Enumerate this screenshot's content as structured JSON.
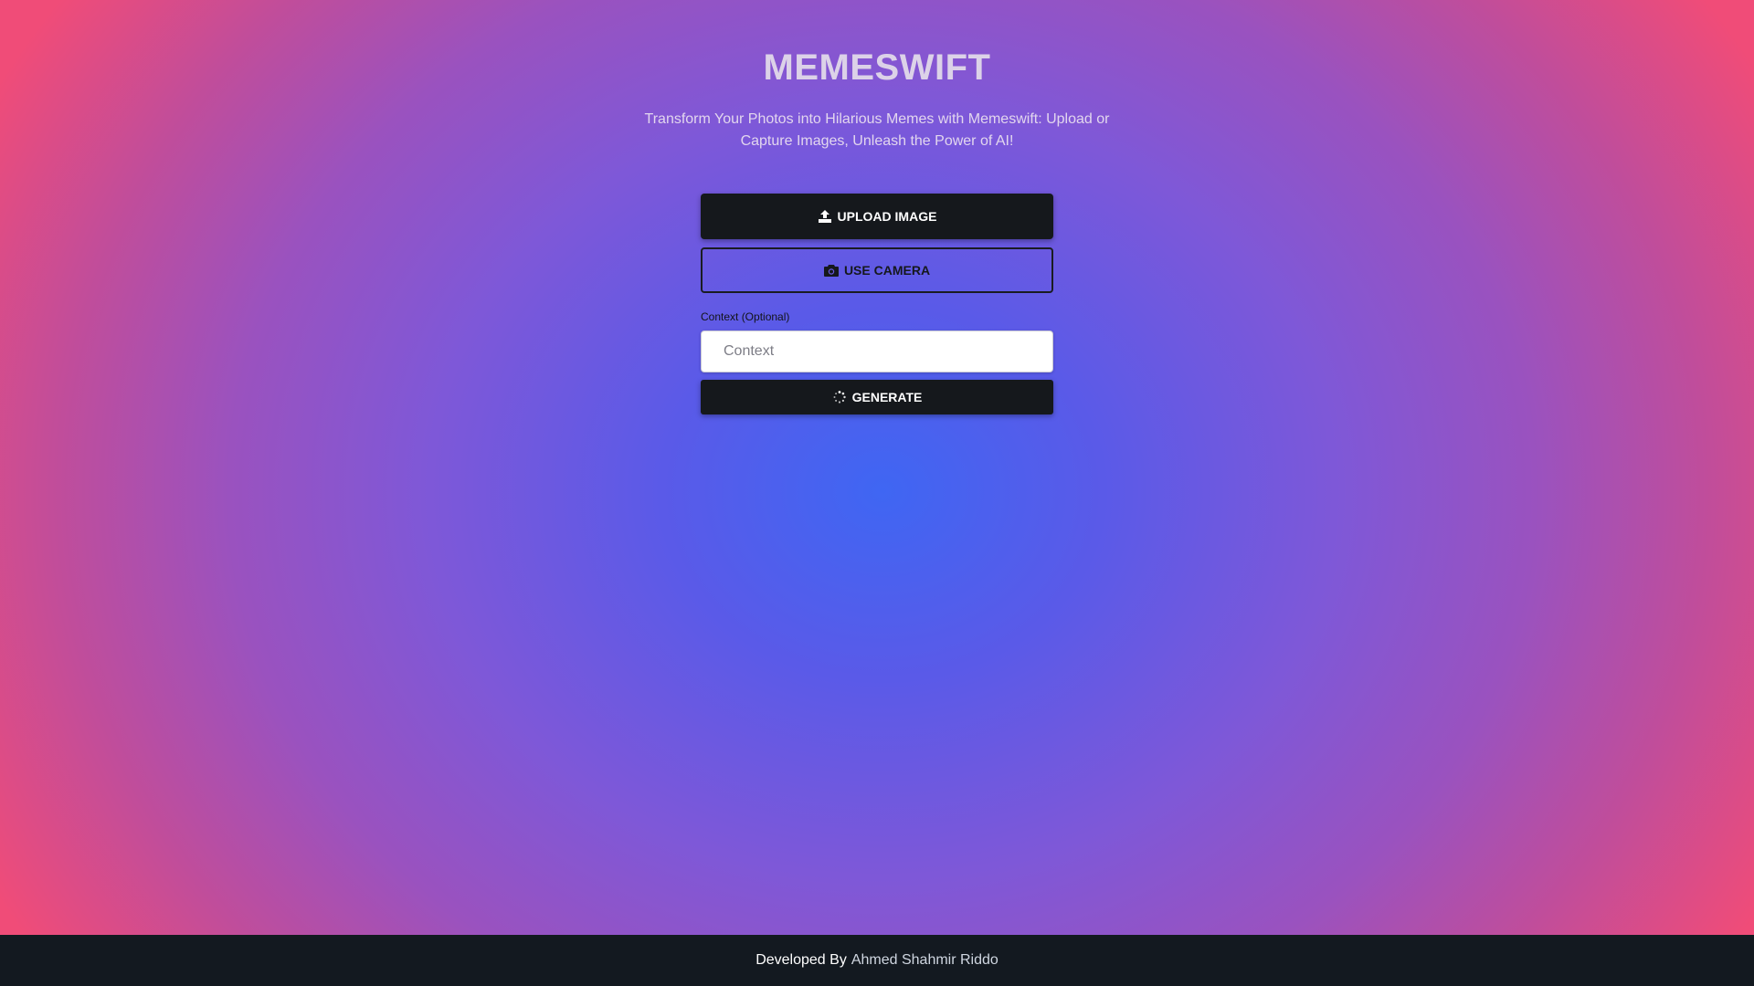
{
  "header": {
    "title": "MEMESWIFT",
    "subtitle": "Transform Your Photos into Hilarious Memes with Memeswift: Upload or Capture Images, Unleash the Power of AI!"
  },
  "actions": {
    "upload_label": "UPLOAD IMAGE",
    "upload_icon": "upload-icon",
    "camera_label": "USE CAMERA",
    "camera_icon": "camera-icon"
  },
  "context": {
    "label": "Context (Optional)",
    "placeholder": "Context",
    "value": ""
  },
  "generate": {
    "label": "GENERATE",
    "icon": "spinner-icon"
  },
  "footer": {
    "prefix": "Developed By",
    "author": "Ahmed Shahmir Riddo"
  },
  "colors": {
    "gradient_center": "#3f66f3",
    "gradient_edge": "#f04c78",
    "button_dark": "#15181c",
    "footer_bg": "#131920"
  }
}
